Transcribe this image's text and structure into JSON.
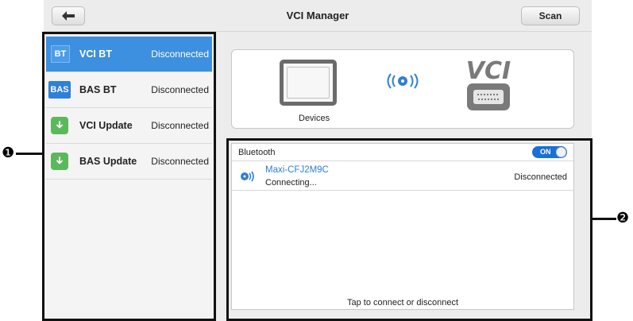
{
  "header": {
    "title": "VCI Manager",
    "scan_label": "Scan",
    "back_icon": "back-arrow-icon"
  },
  "sidebar": {
    "items": [
      {
        "icon_text": "BT",
        "label": "VCI BT",
        "status": "Disconnected",
        "active": true
      },
      {
        "icon_text": "BAS",
        "label": "BAS BT",
        "status": "Disconnected",
        "active": false
      },
      {
        "icon_text": "",
        "icon": "download-icon",
        "label": "VCI Update",
        "status": "Disconnected",
        "active": false
      },
      {
        "icon_text": "",
        "icon": "download-icon",
        "label": "BAS Update",
        "status": "Disconnected",
        "active": false
      }
    ]
  },
  "device_panel": {
    "devices_label": "Devices",
    "vci_logo_text": "VCI"
  },
  "bluetooth": {
    "header_label": "Bluetooth",
    "toggle_label": "ON",
    "toggle_state": true,
    "devices": [
      {
        "name": "Maxi-CFJ2M9C",
        "sub": "Connecting...",
        "status": "Disconnected"
      }
    ],
    "hint": "Tap to connect or disconnect"
  },
  "callouts": {
    "one": "❶",
    "two": "❷"
  },
  "colors": {
    "accent": "#3d8fe0",
    "toggle": "#1c6fd6",
    "update_green": "#5cb85c",
    "device_name": "#2f7fd6"
  }
}
